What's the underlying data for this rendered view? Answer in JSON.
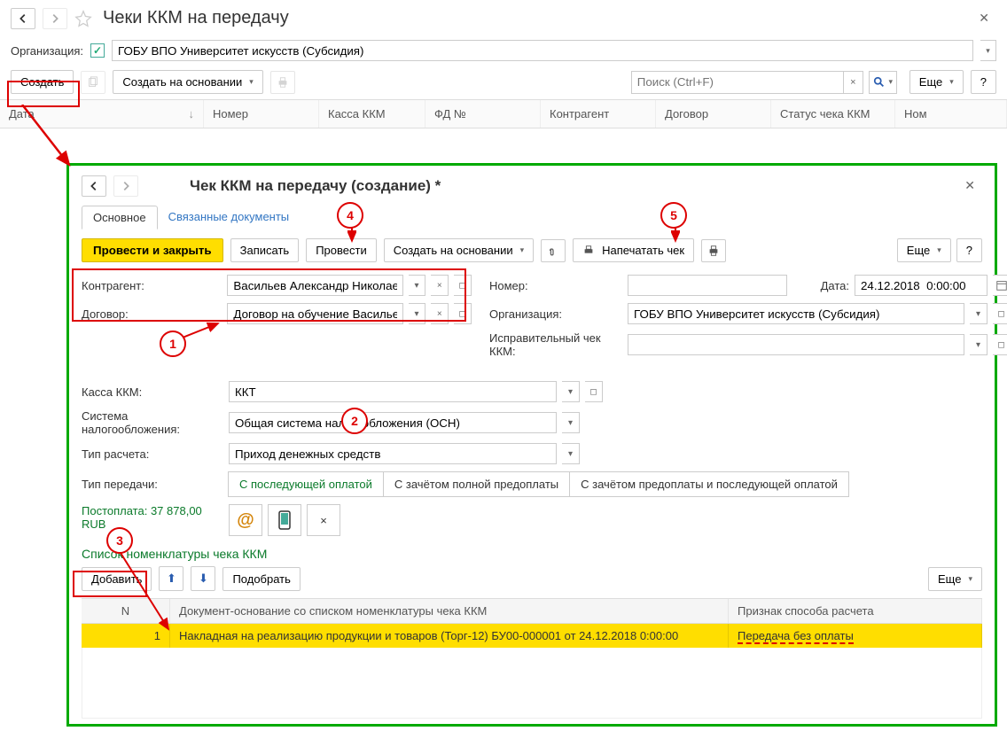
{
  "header": {
    "title": "Чеки ККМ на передачу"
  },
  "org": {
    "label": "Организация:",
    "value": "ГОБУ ВПО Университет искусств (Субсидия)"
  },
  "toolbar": {
    "create": "Создать",
    "create_based": "Создать на основании",
    "search_placeholder": "Поиск (Ctrl+F)",
    "more": "Еще",
    "help": "?"
  },
  "columns": {
    "date": "Дата",
    "number": "Номер",
    "kkm": "Касса ККМ",
    "fd": "ФД №",
    "contragent": "Контрагент",
    "contract": "Договор",
    "status": "Статус чека ККМ",
    "nom": "Ном"
  },
  "dialog": {
    "title": "Чек ККМ на передачу (создание) *",
    "tabs": {
      "main": "Основное",
      "linked": "Связанные документы"
    },
    "tb": {
      "post_close": "Провести и закрыть",
      "save": "Записать",
      "post": "Провести",
      "create_based": "Создать на основании",
      "print_check": "Напечатать чек",
      "more": "Еще",
      "help": "?"
    },
    "fields": {
      "contragent_lbl": "Контрагент:",
      "contragent_val": "Васильев Александр Николаевич",
      "contract_lbl": "Договор:",
      "contract_val": "Договор на обучение Васильев А",
      "number_lbl": "Номер:",
      "date_lbl": "Дата:",
      "date_val": "24.12.2018  0:00:00",
      "org_lbl": "Организация:",
      "org_val": "ГОБУ ВПО Университет искусств (Субсидия)",
      "corr_lbl": "Исправительный чек ККМ:",
      "kkm_lbl": "Касса ККМ:",
      "kkm_val": "ККТ",
      "tax_lbl": "Система налогообложения:",
      "tax_val": "Общая система налогообложения (ОСН)",
      "calc_lbl": "Тип расчета:",
      "calc_val": "Приход денежных средств",
      "transfer_lbl": "Тип передачи:",
      "transfer_opts": [
        "С последующей оплатой",
        "С зачётом полной предоплаты",
        "С зачётом предоплаты и последующей оплатой"
      ],
      "postpay": "Постоплата: 37 878,00 RUB"
    },
    "list": {
      "title": "Список номенклатуры чека ККМ",
      "add": "Добавить",
      "pick": "Подобрать",
      "more": "Еще",
      "cols": {
        "n": "N",
        "doc": "Документ-основание со списком номенклатуры чека ККМ",
        "sign": "Признак способа расчета"
      },
      "row": {
        "n": "1",
        "doc": "Накладная на реализацию продукции и товаров (Торг-12) БУ00-000001 от 24.12.2018 0:00:00",
        "sign": "Передача без оплаты"
      }
    }
  },
  "markers": {
    "1": "1",
    "2": "2",
    "3": "3",
    "4": "4",
    "5": "5"
  }
}
